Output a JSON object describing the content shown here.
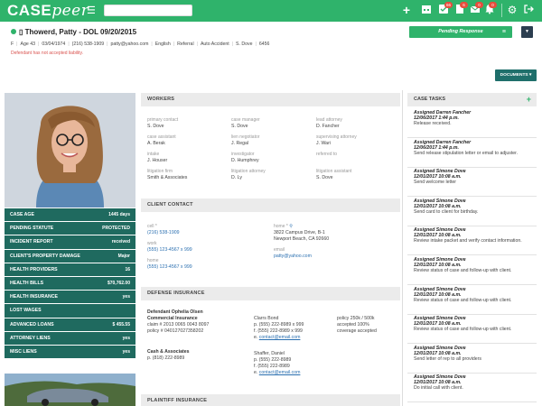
{
  "app": {
    "logo_case": "CASE",
    "logo_peer": "peer"
  },
  "topbar": {
    "search_placeholder": "",
    "icons": [
      "plus-icon",
      "calendar-icon",
      "tasks-icon",
      "document-icon",
      "mail-icon",
      "bell-icon",
      "gear-icon",
      "logout-icon"
    ],
    "badges": {
      "tasks": "66",
      "document": "6",
      "mail": "0",
      "bell": "0"
    }
  },
  "header": {
    "name": "Thowerd, Patty - DOL 09/20/2015",
    "info": [
      "F",
      "Age 43",
      "03/04/1974",
      "(216) 538-1909",
      "patty@yahoo.com",
      "English",
      "Referral",
      "Auto Accident",
      "S. Dove",
      "6456"
    ],
    "warning": "Defendant has not accepted liability.",
    "status_button": "Pending Response",
    "documents_button": "DOCUMENTS"
  },
  "stats": [
    {
      "label": "CASE AGE",
      "value": "1445 days"
    },
    {
      "label": "PENDING STATUTE",
      "value": "PROTECTED"
    },
    {
      "label": "INCIDENT REPORT",
      "value": "received"
    },
    {
      "label": "CLIENT'S PROPERTY DAMAGE",
      "value": "Major"
    },
    {
      "label": "HEALTH PROVIDERS",
      "value": "16"
    },
    {
      "label": "HEALTH BILLS",
      "value": "$70,762.00"
    },
    {
      "label": "HEALTH INSURANCE",
      "value": "yes"
    },
    {
      "label": "LOST WAGES",
      "value": ""
    },
    {
      "label": "ADVANCED LOANS",
      "value": "$ 455.55"
    },
    {
      "label": "ATTORNEY LIENS",
      "value": "yes"
    },
    {
      "label": "MISC LIENS",
      "value": "yes"
    }
  ],
  "workers": {
    "title": "WORKERS",
    "items": [
      {
        "label": "primary contact",
        "value": "S. Dove"
      },
      {
        "label": "case manager",
        "value": "S. Dove"
      },
      {
        "label": "lead attorney",
        "value": "D. Fancher"
      },
      {
        "label": "case assistant",
        "value": "A. Berak"
      },
      {
        "label": "lien negotiator",
        "value": "J. Regal"
      },
      {
        "label": "supervising attorney",
        "value": "J. Wari"
      },
      {
        "label": "intake",
        "value": "J. Houser"
      },
      {
        "label": "investigator",
        "value": "D. Humphrey"
      },
      {
        "label": "referred to",
        "value": ""
      },
      {
        "label": "litigation firm",
        "value": "Smith & Associates"
      },
      {
        "label": "litigation attorney",
        "value": "D. Ly"
      },
      {
        "label": "litigation assistant",
        "value": "S. Dove"
      }
    ]
  },
  "client_contact": {
    "title": "CLIENT CONTACT",
    "cell_label": "cell *",
    "cell": "(216) 538-1909",
    "work_label": "work",
    "work": "(555) 123-4567 x 999",
    "home_label": "home",
    "home": "(555) 123-4567 x 999",
    "address_label": "home *",
    "address1": "3822 Campus Drive, B-1",
    "address2": "Newport Beach, CA 92660",
    "email_label": "email",
    "email": "patty@yahoo.com"
  },
  "defense": {
    "title": "DEFENSE INSURANCE",
    "col1": {
      "defendant": "Defendant Ophelia Olsen",
      "company": "Commercial Insurance",
      "claim": "claim # 2013 0065 0043 8097",
      "policy": "policy # 040127027358202",
      "firm": "Cash & Associates",
      "firm_phone": "p. (818) 222-8989"
    },
    "col2": {
      "name1": "Clarrs Bond",
      "p1": "p. (555) 222-8989 x 999",
      "f1": "f. (555) 222-8989 x 999",
      "e1_label": "e. ",
      "e1": "contact@email.com",
      "name2": "Shaffer, Daniel",
      "p2": "p. (555) 222-8989",
      "f2": "f. (555) 222-8989",
      "e2_label": "e. ",
      "e2": "contact@email.com"
    },
    "col3": {
      "policy": "policy 250k / 500k",
      "accepted": "accepted 100%",
      "coverage": "coverage accepted"
    }
  },
  "plaintiff": {
    "title": "PLAINTIFF INSURANCE"
  },
  "tasks": {
    "title": "CASE TASKS",
    "items": [
      {
        "who": "Assigned Darren Fancher",
        "when": "12/06/2017 1:44 p.m.",
        "desc": "Release received."
      },
      {
        "who": "Assigned Darren Fancher",
        "when": "12/06/2017 1:44 p.m.",
        "desc": "Send release stipulation letter or email to adjuster."
      },
      {
        "who": "Assigned Simone Dove",
        "when": "12/01/2017 10:08 a.m.",
        "desc": "Send welcome letter"
      },
      {
        "who": "Assigned Simone Dove",
        "when": "12/01/2017 10:08 a.m.",
        "desc": "Send card to client for birthday."
      },
      {
        "who": "Assigned Simone Dove",
        "when": "12/01/2017 10:08 a.m.",
        "desc": "Review intake packet and verify contact information."
      },
      {
        "who": "Assigned Simone Dove",
        "when": "12/01/2017 10:08 a.m.",
        "desc": "Review status of case and follow-up with client."
      },
      {
        "who": "Assigned Simone Dove",
        "when": "12/01/2017 10:08 a.m.",
        "desc": "Review status of case and follow-up with client."
      },
      {
        "who": "Assigned Simone Dove",
        "when": "12/01/2017 10:08 a.m.",
        "desc": "Review status of case and follow-up with client."
      },
      {
        "who": "Assigned Simone Dove",
        "when": "12/01/2017 10:08 a.m.",
        "desc": "Send letter of rep to all providers"
      },
      {
        "who": "Assigned Simone Dove",
        "when": "12/01/2017 10:08 a.m.",
        "desc": "Do initial call with client."
      }
    ]
  }
}
